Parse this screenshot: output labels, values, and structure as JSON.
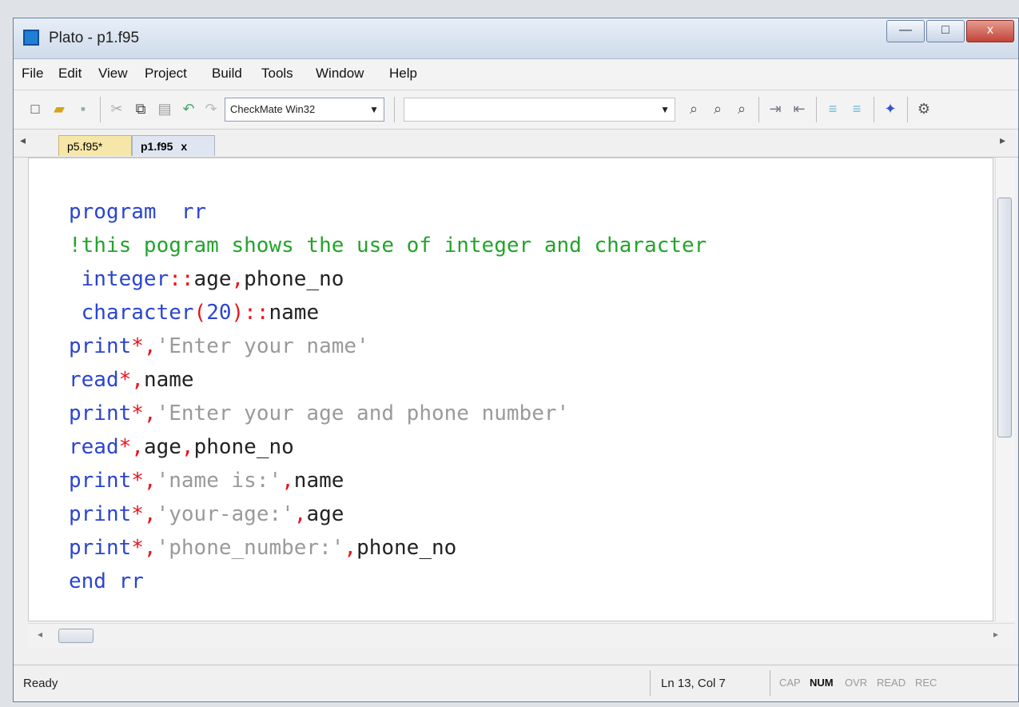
{
  "window": {
    "title": "Plato - p1.f95",
    "controls": [
      "—",
      "□",
      "x"
    ]
  },
  "menu": [
    "File",
    "Edit",
    "View",
    "Project",
    "Build",
    "Tools",
    "Window",
    "Help"
  ],
  "toolbar": {
    "config_combo": "CheckMate Win32",
    "search_combo": ""
  },
  "tabs": [
    {
      "label": "p5.f95*",
      "active": false
    },
    {
      "label": "p1.f95",
      "active": true,
      "close": "x"
    }
  ],
  "code_lines": [
    [
      {
        "t": "program",
        "c": "kw"
      },
      {
        "t": "  rr",
        "c": "kw"
      }
    ],
    [
      {
        "t": "!this pogram shows the use of integer and character",
        "c": "cm"
      }
    ],
    [
      {
        "t": " integer",
        "c": "kw"
      },
      {
        "t": "::",
        "c": "op"
      },
      {
        "t": "age",
        "c": "id"
      },
      {
        "t": ",",
        "c": "op"
      },
      {
        "t": "phone_no",
        "c": "id"
      }
    ],
    [
      {
        "t": " character",
        "c": "kw"
      },
      {
        "t": "(",
        "c": "op"
      },
      {
        "t": "20",
        "c": "kw"
      },
      {
        "t": ")",
        "c": "op"
      },
      {
        "t": "::",
        "c": "op"
      },
      {
        "t": "name",
        "c": "id"
      }
    ],
    [
      {
        "t": "print",
        "c": "kw"
      },
      {
        "t": "*,",
        "c": "op"
      },
      {
        "t": "'Enter your name'",
        "c": "st"
      }
    ],
    [
      {
        "t": "read",
        "c": "kw"
      },
      {
        "t": "*,",
        "c": "op"
      },
      {
        "t": "name",
        "c": "id"
      }
    ],
    [
      {
        "t": "print",
        "c": "kw"
      },
      {
        "t": "*,",
        "c": "op"
      },
      {
        "t": "'Enter your age and phone number'",
        "c": "st"
      }
    ],
    [
      {
        "t": "read",
        "c": "kw"
      },
      {
        "t": "*,",
        "c": "op"
      },
      {
        "t": "age",
        "c": "id"
      },
      {
        "t": ",",
        "c": "op"
      },
      {
        "t": "phone_no",
        "c": "id"
      }
    ],
    [
      {
        "t": "print",
        "c": "kw"
      },
      {
        "t": "*,",
        "c": "op"
      },
      {
        "t": "'name is:'",
        "c": "st"
      },
      {
        "t": ",",
        "c": "op"
      },
      {
        "t": "name",
        "c": "id"
      }
    ],
    [
      {
        "t": "print",
        "c": "kw"
      },
      {
        "t": "*,",
        "c": "op"
      },
      {
        "t": "'your-age:'",
        "c": "st"
      },
      {
        "t": ",",
        "c": "op"
      },
      {
        "t": "age",
        "c": "id"
      }
    ],
    [
      {
        "t": "print",
        "c": "kw"
      },
      {
        "t": "*,",
        "c": "op"
      },
      {
        "t": "'phone_number:'",
        "c": "st"
      },
      {
        "t": ",",
        "c": "op"
      },
      {
        "t": "phone_no",
        "c": "id"
      }
    ],
    [
      {
        "t": "end rr",
        "c": "kw"
      }
    ]
  ],
  "status": {
    "ready": "Ready",
    "position": "Ln 13, Col 7",
    "indicators": [
      {
        "label": "CAP",
        "on": false
      },
      {
        "label": "NUM",
        "on": true
      },
      {
        "label": "OVR",
        "on": false
      },
      {
        "label": "READ",
        "on": false
      },
      {
        "label": "REC",
        "on": false
      }
    ]
  },
  "colors": {
    "keyword": "#2b45d0",
    "comment": "#24a32b",
    "string": "#9a9a9a",
    "operator": "#e8141b",
    "identifier": "#222222",
    "active_tab": "#dfe6f1",
    "inactive_tab": "#f6e7a8"
  },
  "icons": {
    "new": "new-file-icon",
    "open": "open-folder-icon",
    "save": "save-icon",
    "cut": "cut-icon",
    "copy": "copy-icon",
    "paste": "paste-icon",
    "undo": "undo-icon",
    "redo": "redo-icon"
  }
}
